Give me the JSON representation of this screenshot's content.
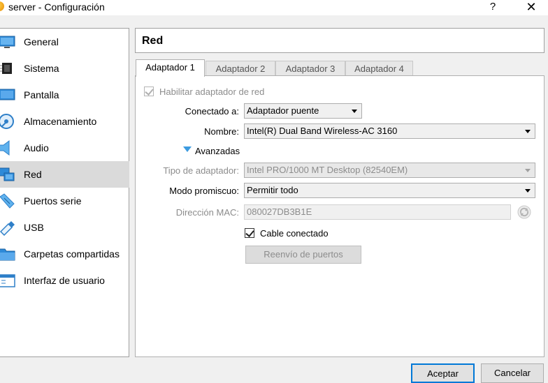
{
  "window": {
    "title": "server - Configuración",
    "help": "?",
    "close": "✕"
  },
  "sidebar": {
    "items": [
      {
        "label": "General"
      },
      {
        "label": "Sistema"
      },
      {
        "label": "Pantalla"
      },
      {
        "label": "Almacenamiento"
      },
      {
        "label": "Audio"
      },
      {
        "label": "Red"
      },
      {
        "label": "Puertos serie"
      },
      {
        "label": "USB"
      },
      {
        "label": "Carpetas compartidas"
      },
      {
        "label": "Interfaz de usuario"
      }
    ],
    "selected": "Red"
  },
  "header": {
    "title": "Red"
  },
  "tabs": [
    {
      "label": "Adaptador 1"
    },
    {
      "label": "Adaptador 2"
    },
    {
      "label": "Adaptador 3"
    },
    {
      "label": "Adaptador 4"
    }
  ],
  "form": {
    "enable_label": "Habilitar adaptador de red",
    "attached_label": "Conectado a:",
    "attached_value": "Adaptador puente",
    "name_label": "Nombre:",
    "name_value": "Intel(R) Dual Band Wireless-AC 3160",
    "advanced_label": "Avanzadas",
    "adapter_type_label": "Tipo de adaptador:",
    "adapter_type_value": "Intel PRO/1000 MT Desktop (82540EM)",
    "promisc_label": "Modo promiscuo:",
    "promisc_value": "Permitir todo",
    "mac_label": "Dirección MAC:",
    "mac_value": "080027DB3B1E",
    "cable_label": "Cable conectado",
    "port_forward_label": "Reenvío de puertos"
  },
  "buttons": {
    "ok": "Aceptar",
    "cancel": "Cancelar"
  },
  "colors": {
    "accent": "#0078d7",
    "selection": "#dadada",
    "tri": "#3c9be0"
  }
}
